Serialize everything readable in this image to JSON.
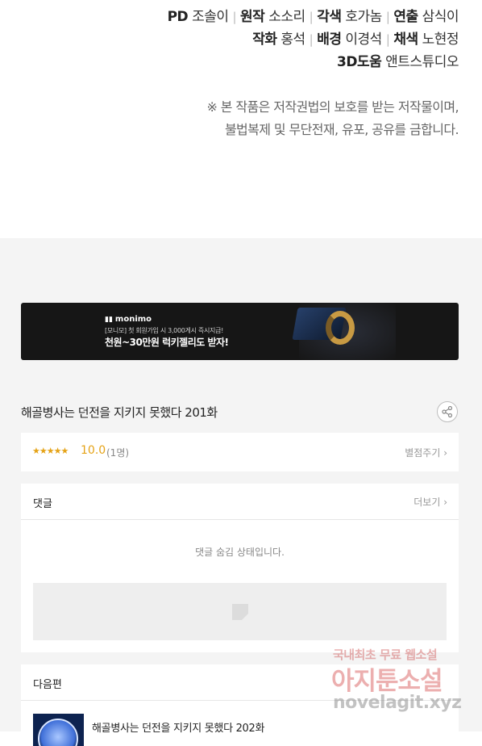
{
  "credits": {
    "line1": [
      {
        "role": "PD",
        "name": "조솔이"
      },
      {
        "role": "원작",
        "name": "소소리"
      },
      {
        "role": "각색",
        "name": "호가놈"
      },
      {
        "role": "연출",
        "name": "삼식이"
      }
    ],
    "line2": [
      {
        "role": "작화",
        "name": "홍석"
      },
      {
        "role": "배경",
        "name": "이경석"
      },
      {
        "role": "채색",
        "name": "노현정"
      }
    ],
    "line3": [
      {
        "role": "3D도움",
        "name": "앤트스튜디오"
      }
    ],
    "separator": "|",
    "notice_line1": "※ 본 작품은 저작권법의 보호를 받는 저작물이며,",
    "notice_line2": "불법복제 및 무단전재, 유포, 공유를 금합니다."
  },
  "banner": {
    "logo": "monimo",
    "sub": "[모니모] 첫 회원가입 시 3,000게시 즉시지급!",
    "main": "천원~30만원 럭키젤리도 받자!"
  },
  "episode": {
    "title": "해골병사는 던전을 지키지 못했다 201화",
    "share_icon": "share-icon"
  },
  "rating": {
    "stars": "★★★★★",
    "score": "10.0",
    "count": "(1명)",
    "link": "별점주기 ›"
  },
  "comments": {
    "title": "댓글",
    "more": "더보기 ›",
    "hidden_text": "댓글 숨김 상태입니다."
  },
  "next": {
    "title": "다음편",
    "episode_title": "해골병사는 던전을 지키지 못했다 202화"
  },
  "watermark": {
    "line1": "국내최초 무료 웹소설",
    "line2": "아지툰소설",
    "line3": "novelagit.xyz"
  },
  "colors": {
    "accent_star": "#e5a317",
    "background_gray": "#f4f4f4"
  }
}
